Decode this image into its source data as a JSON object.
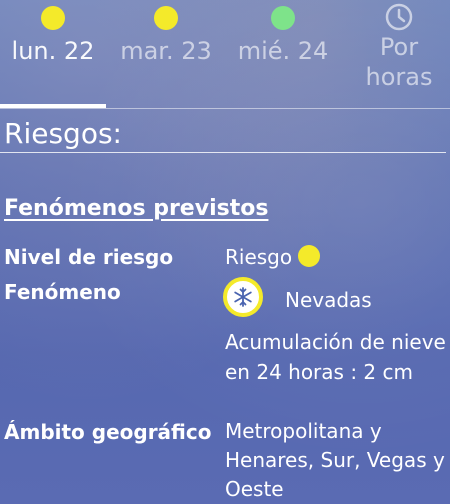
{
  "tabs": [
    {
      "label": "lun. 22",
      "dot_color": "#f4ea2a",
      "active": true
    },
    {
      "label": "mar. 23",
      "dot_color": "#f4ea2a",
      "active": false
    },
    {
      "label": "mié. 24",
      "dot_color": "#7ee38a",
      "active": false
    },
    {
      "label": "Por\nhoras",
      "icon": "clock-icon",
      "active": false
    }
  ],
  "section": {
    "title": "Riesgos:"
  },
  "phenomena": {
    "title": "Fenómenos previstos",
    "risk_level": {
      "label": "Nivel de riesgo",
      "value": "Riesgo",
      "color": "#f4ea2a"
    },
    "phenomenon": {
      "label": "Fenómeno",
      "value": "Nevadas",
      "icon": "snowflake-icon",
      "description": "Acumulación de nieve en 24 horas : 2 cm"
    },
    "scope": {
      "label": "Ámbito geográfico",
      "value": "Metropolitana y Henares, Sur, Vegas y Oeste"
    }
  }
}
